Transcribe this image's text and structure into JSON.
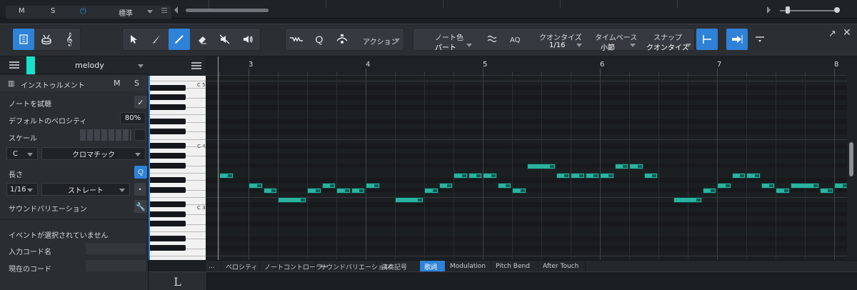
{
  "top_strip": {
    "mute": "M",
    "solo": "S",
    "preset": "標準"
  },
  "toolbar": {
    "action": "アクション",
    "note_color_label": "ノート色",
    "note_color_value": "パート",
    "aq": "AQ",
    "quantize_label": "クオンタイズ",
    "quantize_value": "1/16",
    "timebase_label": "タイムベース",
    "timebase_value": "小節",
    "snap_label": "スナップ",
    "snap_value": "クオンタイズ"
  },
  "inspector": {
    "track_name": "melody",
    "track_color": "#19e0c8",
    "instrument": "インストゥルメント",
    "mute": "M",
    "solo": "S",
    "audition_notes": "ノートを試聴",
    "default_velocity_label": "デフォルトのベロシティ",
    "default_velocity_value": "80%",
    "scale_label": "スケール",
    "scale_root": "C",
    "scale_type": "クロマチック",
    "length_label": "長さ",
    "length_value": "1/16",
    "length_type": "ストレート",
    "sound_variation": "サウンドバリエーション",
    "no_event_selected": "イベントが選択されていません",
    "input_chord_label": "入力コード名",
    "current_chord_label": "現在のコード"
  },
  "keyboard": {
    "labels": [
      "C 5",
      "C 4",
      "C 3"
    ]
  },
  "ruler": {
    "bars": [
      "3",
      "4",
      "5",
      "6",
      "7",
      "8"
    ]
  },
  "lanes": {
    "more": "...",
    "tabs": [
      "ベロシティ",
      "ノートコントローラー",
      "サウンドバリエーション",
      "演奏記号",
      "歌詞",
      "Modulation",
      "Pitch Bend",
      "After Touch"
    ],
    "active_tab": "歌詞"
  },
  "bottom": {
    "lyric_key": "L"
  },
  "colors": {
    "accent": "#2e82d8",
    "note": "#2ab3a0",
    "track": "#19e0c8"
  }
}
